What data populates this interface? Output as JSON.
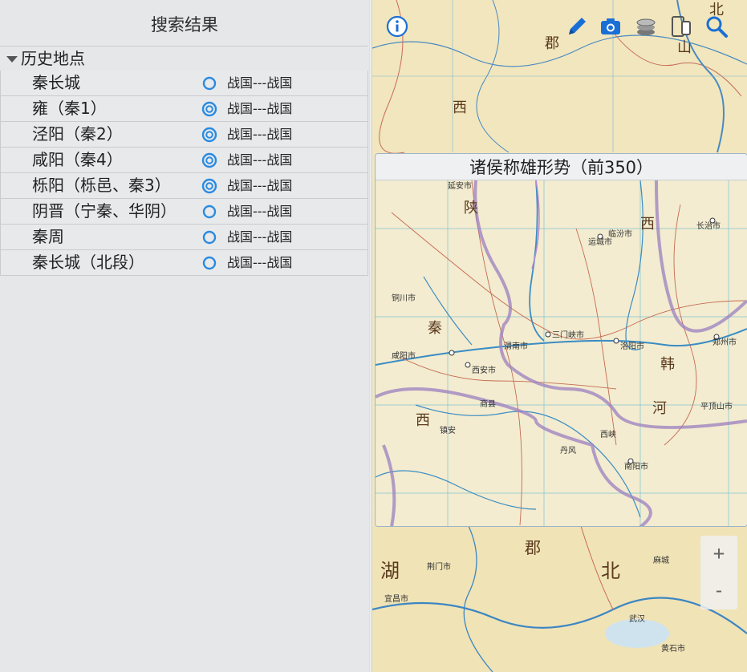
{
  "panel": {
    "title": "搜索结果",
    "group_label": "历史地点",
    "rows": [
      {
        "name": "秦长城",
        "period": "战国---战国",
        "pin": "single"
      },
      {
        "name": "雍（秦1）",
        "period": "战国---战国",
        "pin": "double"
      },
      {
        "name": "泾阳（秦2）",
        "period": "战国---战国",
        "pin": "double"
      },
      {
        "name": "咸阳（秦4）",
        "period": "战国---战国",
        "pin": "double"
      },
      {
        "name": "栎阳（栎邑、秦3）",
        "period": "战国---战国",
        "pin": "double"
      },
      {
        "name": "阴晋（宁秦、华阴）",
        "period": "战国---战国",
        "pin": "single"
      },
      {
        "name": "秦周",
        "period": "战国---战国",
        "pin": "single"
      },
      {
        "name": "秦长城（北段）",
        "period": "战国---战国",
        "pin": "single"
      }
    ]
  },
  "map": {
    "popup_title": "诸侯称雄形势（前350）",
    "toolbar": [
      "info-icon",
      "pencil-icon",
      "camera-icon",
      "layers-icon",
      "device-icon",
      "search-icon"
    ],
    "zoom_in": "+",
    "zoom_out": "-",
    "colors": {
      "accent": "#1a6fd6",
      "border": "#9b7fc0",
      "paper": "#f3ecd0"
    },
    "labels": {
      "top": [
        "郡",
        "西",
        "北",
        "山"
      ],
      "popup": [
        "延安市",
        "陕",
        "西",
        "铜川市",
        "秦",
        "咸阳市",
        "西安市",
        "渭南市",
        "三门峡市",
        "洛阳市",
        "韩",
        "河",
        "南阳市",
        "郑州市",
        "运城市",
        "临汾市",
        "长治市",
        "平顶山市",
        "商县",
        "镇安",
        "丹风",
        "西峡"
      ],
      "bottom": [
        "郡",
        "湖",
        "北",
        "荆门市",
        "宜昌市",
        "麻城",
        "黄石市",
        "武汉"
      ]
    }
  }
}
